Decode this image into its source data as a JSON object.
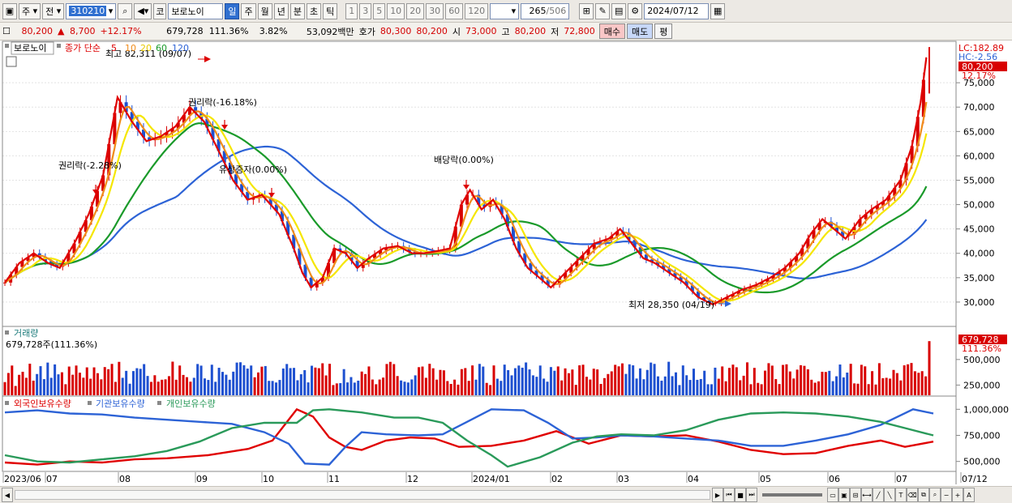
{
  "toolbar": {
    "period_a": "주",
    "period_b": "전",
    "code": "310210",
    "market_mark": "코",
    "stock_name": "보로노이",
    "tabs": [
      "일",
      "주",
      "월",
      "년",
      "분",
      "초",
      "틱"
    ],
    "active_tab": "일",
    "nums": [
      "1",
      "3",
      "5",
      "10",
      "20",
      "30",
      "60",
      "120"
    ],
    "count": "265",
    "total": "/506",
    "date": "2024/07/12"
  },
  "quote": {
    "price": "80,200",
    "arrow": "▲",
    "change": "8,700",
    "change_pct": "+12.17%",
    "volume": "679,728",
    "vol_ratio": "111.36%",
    "turnover": "3.82%",
    "amount": "53,092백만",
    "hoga_label": "호가",
    "hoga1": "80,300",
    "hoga2": "80,200",
    "open_label": "시",
    "open": "73,000",
    "high_label": "고",
    "high": "80,200",
    "low_label": "저",
    "low": "72,800",
    "buy": "매수",
    "sell": "매도",
    "eval": "평"
  },
  "legend": {
    "name": "보로노이",
    "ma_label": "종가 단순",
    "ma": [
      "5",
      "10",
      "20",
      "60",
      "120"
    ],
    "volume_label": "거래량",
    "volume_text": "679,728주(111.36%)",
    "holdings": [
      "외국인보유수량",
      "기관보유수량",
      "개인보유수량"
    ]
  },
  "right_labels": {
    "lc": "LC:182.89",
    "hc": "HC:-2.56",
    "price_tag": "80,200",
    "pct_tag": "12.17%",
    "vol_tag": "679,728",
    "vol_pct_tag": "111.36%"
  },
  "colors": {
    "up": "#d80000",
    "down": "#1e50d0",
    "ma5": "#e00000",
    "ma10": "#f08c1a",
    "ma20": "#f5e600",
    "ma60": "#1a9a2a",
    "ma120": "#2d63d6",
    "foreign": "#e00000",
    "inst": "#2d63d6",
    "indiv": "#2a9a5a"
  },
  "chart_data": [
    {
      "type": "candlestick",
      "title": "보로노이",
      "x_months": [
        "2023/06",
        "07",
        "08",
        "09",
        "10",
        "11",
        "12",
        "2024/01",
        "02",
        "03",
        "04",
        "05",
        "06",
        "07",
        "07/12"
      ],
      "ylim": [
        25500,
        83000
      ],
      "y_ticks": [
        30000,
        35000,
        40000,
        45000,
        50000,
        55000,
        60000,
        65000,
        70000,
        75000
      ],
      "series": [
        {
          "name": "종가",
          "points": [
            [
              0,
              34000
            ],
            [
              10,
              38000
            ],
            [
              20,
              40000
            ],
            [
              30,
              38000
            ],
            [
              38,
              37000
            ],
            [
              48,
              42000
            ],
            [
              58,
              48000
            ],
            [
              68,
              56000
            ],
            [
              78,
              72000
            ],
            [
              88,
              67000
            ],
            [
              98,
              63000
            ],
            [
              108,
              64000
            ],
            [
              118,
              66000
            ],
            [
              128,
              70000
            ],
            [
              138,
              67000
            ],
            [
              148,
              61000
            ],
            [
              158,
              55000
            ],
            [
              168,
              51000
            ],
            [
              178,
              52000
            ],
            [
              190,
              48000
            ],
            [
              200,
              41000
            ],
            [
              206,
              36000
            ],
            [
              212,
              33000
            ],
            [
              220,
              35000
            ],
            [
              228,
              41000
            ],
            [
              236,
              40000
            ],
            [
              244,
              37000
            ],
            [
              252,
              39000
            ],
            [
              262,
              41000
            ],
            [
              272,
              41500
            ],
            [
              282,
              40000
            ],
            [
              290,
              40000
            ],
            [
              300,
              40500
            ],
            [
              308,
              41000
            ],
            [
              316,
              50000
            ],
            [
              322,
              53000
            ],
            [
              330,
              49000
            ],
            [
              338,
              51000
            ],
            [
              346,
              47000
            ],
            [
              354,
              41000
            ],
            [
              362,
              37000
            ],
            [
              370,
              35000
            ],
            [
              378,
              33000
            ],
            [
              388,
              36000
            ],
            [
              398,
              39000
            ],
            [
              408,
              42000
            ],
            [
              418,
              43000
            ],
            [
              426,
              45000
            ],
            [
              434,
              42000
            ],
            [
              442,
              39000
            ],
            [
              450,
              38000
            ],
            [
              460,
              36000
            ],
            [
              470,
              34000
            ],
            [
              480,
              31000
            ],
            [
              490,
              29500
            ],
            [
              500,
              31000
            ],
            [
              510,
              32500
            ],
            [
              520,
              33500
            ],
            [
              530,
              35000
            ],
            [
              540,
              37000
            ],
            [
              550,
              40000
            ],
            [
              558,
              44000
            ],
            [
              566,
              47000
            ],
            [
              574,
              45000
            ],
            [
              582,
              43000
            ],
            [
              592,
              47000
            ],
            [
              600,
              49000
            ],
            [
              610,
              51000
            ],
            [
              620,
              55000
            ],
            [
              628,
              62000
            ],
            [
              634,
              71000
            ],
            [
              638,
              80200
            ]
          ]
        },
        {
          "name": "최고",
          "value": 82311,
          "date": "09/07"
        },
        {
          "name": "최저",
          "value": 28350,
          "date": "04/19"
        }
      ],
      "annotations": [
        "최고 82,311 (09/07)",
        "권리락(-2.28%)",
        "권리락(-16.18%)",
        "유상증자(0.00%)",
        "배당락(0.00%)",
        "최저 28,350 (04/19)"
      ]
    },
    {
      "type": "bar",
      "title": "거래량",
      "ylim": [
        150000,
        800000
      ],
      "y_ticks": [
        250000,
        500000
      ],
      "values": [
        279000,
        368000,
        441000,
        241000,
        350000,
        380000,
        321000,
        459000,
        293000,
        358000,
        435000,
        308000,
        470000,
        321000,
        452000,
        355000,
        375000,
        258000,
        431000,
        351000,
        441000,
        371000,
        322000,
        423000,
        312000,
        423000,
        366000,
        306000,
        426000,
        405000,
        457000,
        281000,
        477000,
        321000,
        389000,
        263000,
        387000,
        415000,
        409000,
        455000,
        339000,
        281000,
        346000,
        283000,
        302000,
        306000,
        337000,
        479000,
        302000,
        441000,
        349000,
        327000,
        283000,
        321000,
        456000,
        440000,
        315000,
        300000,
        449000,
        282000,
        419000,
        379000,
        351000,
        302000,
        381000,
        470000,
        473000,
        444000,
        411000,
        441000,
        326000,
        373000,
        430000,
        436000,
        291000,
        290000,
        275000,
        300000,
        412000,
        456000,
        416000,
        418000,
        297000,
        356000,
        396000,
        276000,
        439000,
        421000,
        415000,
        463000,
        344000,
        458000,
        250000,
        266000,
        269000,
        406000,
        276000,
        328000,
        274000,
        293000,
        382000,
        358000,
        432000,
        304000,
        258000,
        304000,
        323000,
        456000,
        477000,
        455000,
        338000,
        295000,
        283000,
        275000,
        305000,
        345000,
        425000,
        431000,
        321000,
        458000,
        414000,
        303000,
        398000,
        394000,
        289000,
        261000,
        303000,
        254000,
        406000,
        416000,
        291000,
        442000,
        303000,
        457000,
        431000,
        271000,
        250000,
        442000,
        312000,
        291000,
        450000,
        396000,
        345000,
        415000,
        441000,
        420000,
        471000,
        403000,
        345000,
        331000,
        441000,
        313000,
        283000,
        426000,
        390000,
        432000,
        295000,
        413000,
        366000,
        402000,
        252000,
        443000,
        449000,
        331000,
        304000,
        410000,
        403000,
        261000,
        318000,
        358000,
        384000,
        448000,
        433000,
        462000,
        359000,
        453000,
        443000,
        314000,
        413000,
        307000,
        398000,
        470000,
        457000,
        335000,
        293000,
        334000,
        478000,
        337000,
        374000,
        250000,
        442000,
        346000,
        300000,
        410000,
        301000,
        309000,
        390000,
        258000,
        258000,
        420000,
        312000,
        432000,
        287000,
        418000,
        450000,
        424000,
        297000,
        341000,
        472000,
        258000,
        418000,
        271000,
        258000,
        391000,
        464000,
        440000,
        308000,
        260000,
        447000,
        453000,
        383000,
        314000,
        401000,
        444000,
        438000,
        404000,
        302000,
        273000,
        286000,
        380000,
        378000,
        389000,
        288000,
        336000,
        451000,
        325000,
        372000,
        458000,
        266000,
        263000,
        448000,
        433000,
        259000,
        386000,
        255000,
        464000,
        317000,
        321000,
        313000,
        398000,
        367000,
        295000,
        443000,
        453000,
        466000,
        385000,
        370000,
        386000,
        335000,
        679728
      ]
    },
    {
      "type": "line",
      "title": "보유수량",
      "ylim": [
        420000,
        1080000
      ],
      "y_ticks": [
        500000,
        750000,
        1000000
      ],
      "series": [
        {
          "name": "외국인보유수량",
          "points": [
            [
              0,
              490000
            ],
            [
              40,
              470000
            ],
            [
              80,
              500000
            ],
            [
              120,
              490000
            ],
            [
              160,
              520000
            ],
            [
              200,
              530000
            ],
            [
              250,
              560000
            ],
            [
              300,
              620000
            ],
            [
              330,
              700000
            ],
            [
              360,
              1000000
            ],
            [
              380,
              930000
            ],
            [
              400,
              730000
            ],
            [
              420,
              640000
            ],
            [
              440,
              610000
            ],
            [
              470,
              700000
            ],
            [
              500,
              730000
            ],
            [
              530,
              720000
            ],
            [
              560,
              640000
            ],
            [
              600,
              650000
            ],
            [
              640,
              700000
            ],
            [
              680,
              790000
            ],
            [
              720,
              670000
            ],
            [
              760,
              750000
            ],
            [
              800,
              740000
            ],
            [
              840,
              750000
            ],
            [
              880,
              690000
            ],
            [
              920,
              610000
            ],
            [
              960,
              570000
            ],
            [
              1000,
              580000
            ],
            [
              1040,
              650000
            ],
            [
              1080,
              700000
            ],
            [
              1110,
              640000
            ],
            [
              1145,
              690000
            ]
          ]
        },
        {
          "name": "기관보유수량",
          "points": [
            [
              0,
              970000
            ],
            [
              40,
              990000
            ],
            [
              80,
              960000
            ],
            [
              120,
              950000
            ],
            [
              160,
              920000
            ],
            [
              200,
              900000
            ],
            [
              240,
              880000
            ],
            [
              280,
              860000
            ],
            [
              320,
              780000
            ],
            [
              350,
              670000
            ],
            [
              370,
              480000
            ],
            [
              400,
              470000
            ],
            [
              420,
              640000
            ],
            [
              440,
              780000
            ],
            [
              470,
              760000
            ],
            [
              510,
              750000
            ],
            [
              540,
              760000
            ],
            [
              570,
              880000
            ],
            [
              600,
              1000000
            ],
            [
              640,
              990000
            ],
            [
              670,
              870000
            ],
            [
              700,
              720000
            ],
            [
              730,
              730000
            ],
            [
              760,
              750000
            ],
            [
              800,
              740000
            ],
            [
              840,
              720000
            ],
            [
              880,
              700000
            ],
            [
              920,
              650000
            ],
            [
              960,
              650000
            ],
            [
              1000,
              700000
            ],
            [
              1040,
              760000
            ],
            [
              1080,
              850000
            ],
            [
              1120,
              1000000
            ],
            [
              1145,
              960000
            ]
          ]
        },
        {
          "name": "개인보유수량",
          "points": [
            [
              0,
              560000
            ],
            [
              40,
              500000
            ],
            [
              80,
              490000
            ],
            [
              120,
              520000
            ],
            [
              160,
              550000
            ],
            [
              200,
              600000
            ],
            [
              240,
              690000
            ],
            [
              280,
              820000
            ],
            [
              320,
              870000
            ],
            [
              360,
              870000
            ],
            [
              380,
              990000
            ],
            [
              400,
              1000000
            ],
            [
              440,
              970000
            ],
            [
              480,
              920000
            ],
            [
              510,
              920000
            ],
            [
              540,
              870000
            ],
            [
              570,
              700000
            ],
            [
              600,
              560000
            ],
            [
              620,
              450000
            ],
            [
              660,
              540000
            ],
            [
              700,
              680000
            ],
            [
              730,
              740000
            ],
            [
              760,
              760000
            ],
            [
              800,
              750000
            ],
            [
              840,
              800000
            ],
            [
              880,
              900000
            ],
            [
              920,
              960000
            ],
            [
              960,
              970000
            ],
            [
              1000,
              960000
            ],
            [
              1040,
              930000
            ],
            [
              1080,
              880000
            ],
            [
              1110,
              820000
            ],
            [
              1145,
              750000
            ]
          ]
        }
      ]
    }
  ],
  "bottom": {
    "zoom_plus": "+",
    "zoom_minus": "−",
    "font_a": "A"
  }
}
